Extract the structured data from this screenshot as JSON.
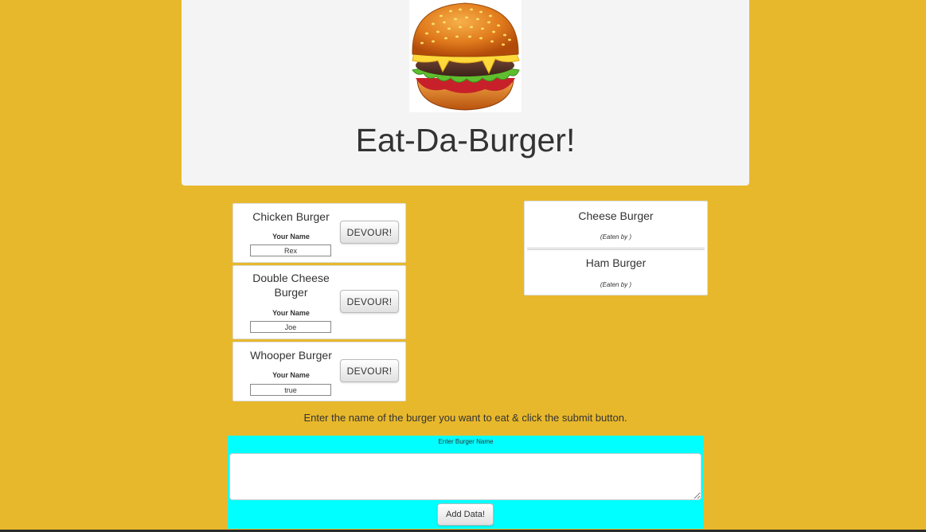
{
  "header": {
    "title": "Eat-Da-Burger!",
    "logo_icon": "hamburger-logo-icon"
  },
  "burgers": [
    {
      "name": "Chicken Burger",
      "name_label": "Your Name",
      "name_value": "Rex",
      "button": "DEVOUR!"
    },
    {
      "name": "Double Cheese Burger",
      "name_label": "Your Name",
      "name_value": "Joe",
      "button": "DEVOUR!"
    },
    {
      "name": "Whooper Burger",
      "name_label": "Your Name",
      "name_value": "true",
      "button": "DEVOUR!"
    }
  ],
  "devoured": [
    {
      "name": "Cheese Burger",
      "eaten_by": "(Eaten by )"
    },
    {
      "name": "Ham Burger",
      "eaten_by": "(Eaten by )"
    }
  ],
  "instructions": "Enter the name of the burger you want to eat & click the submit button.",
  "form": {
    "label": "Enter Burger Name",
    "textarea_value": "",
    "submit_label": "Add Data!"
  },
  "colors": {
    "page_background": "#E8B82C",
    "header_background": "#F4F4F4",
    "form_background": "#00FFFF"
  }
}
